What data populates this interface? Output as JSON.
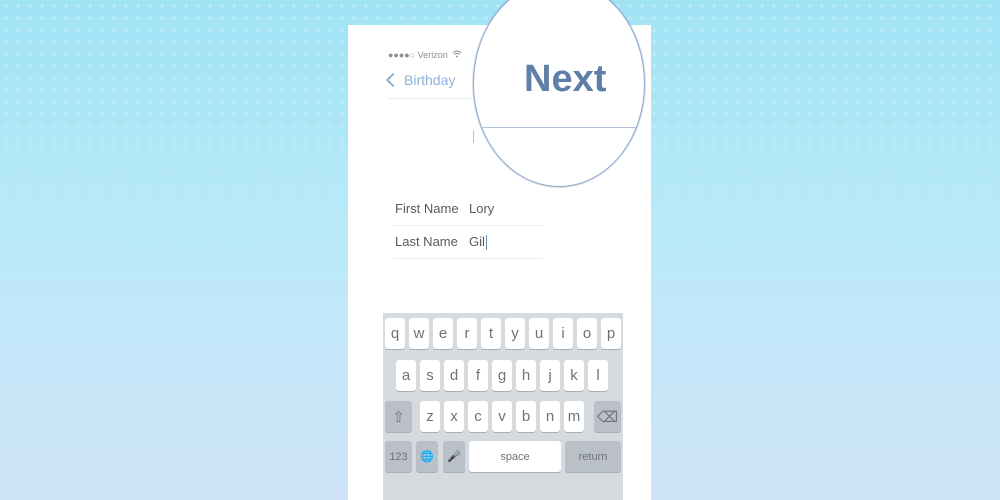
{
  "status_bar": {
    "carrier": "●●●●○ Verizon",
    "wifi_icon": "wifi-icon"
  },
  "nav": {
    "back_label": "Birthday",
    "next_label": "Next"
  },
  "form": {
    "first_name": {
      "label": "First Name",
      "value": "Lory"
    },
    "last_name": {
      "label": "Last Name",
      "value": "Gil"
    }
  },
  "keyboard": {
    "row1": [
      "q",
      "w",
      "e",
      "r",
      "t",
      "y",
      "u",
      "i",
      "o",
      "p"
    ],
    "row2": [
      "a",
      "s",
      "d",
      "f",
      "g",
      "h",
      "j",
      "k",
      "l"
    ],
    "row3": [
      "z",
      "x",
      "c",
      "v",
      "b",
      "n",
      "m"
    ],
    "shift_icon": "⇧",
    "delete_icon": "⌫",
    "numbers_label": "123",
    "globe_icon": "🌐",
    "mic_icon": "🎤",
    "space_label": "space",
    "return_label": "return"
  },
  "colors": {
    "accent": "#5f7fa8",
    "background_top": "#9fe3f5",
    "background_bottom": "#cfe3f8"
  }
}
